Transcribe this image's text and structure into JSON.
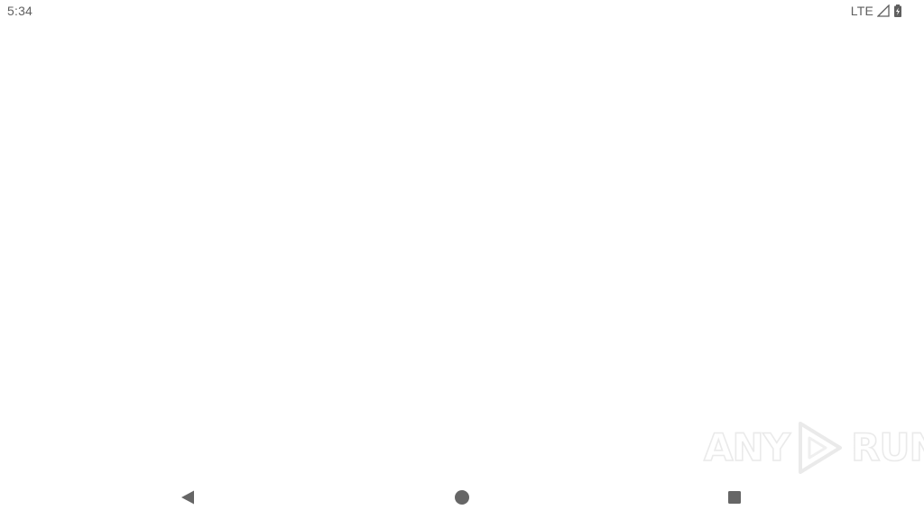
{
  "status_bar": {
    "time": "5:34",
    "network": "LTE",
    "icons": [
      "signal-icon",
      "battery-charging-icon"
    ],
    "icon_color": "#5f5f5f"
  },
  "app_content": {
    "background": "#ffffff"
  },
  "watermark": {
    "text_left": "ANY",
    "text_right": "RUN",
    "logo": "play-triangle-logo"
  },
  "nav_bar": {
    "buttons": [
      {
        "name": "back",
        "icon": "back-triangle-icon"
      },
      {
        "name": "home",
        "icon": "home-circle-icon"
      },
      {
        "name": "recents",
        "icon": "recents-square-icon"
      }
    ],
    "icon_color": "#666666"
  }
}
